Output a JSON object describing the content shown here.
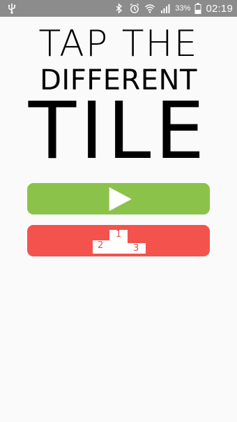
{
  "status_bar": {
    "battery_percent": "33%",
    "clock": "02:19"
  },
  "title": {
    "line1": "TAP THE",
    "line2": "DIFFERENT",
    "line3": "TILE"
  },
  "buttons": {
    "play": {
      "color": "#8bc34a",
      "icon": "play-icon"
    },
    "leaderboard": {
      "color": "#f4524d",
      "icon": "podium-icon",
      "ranks": {
        "first": "1",
        "second": "2",
        "third": "3"
      }
    }
  }
}
